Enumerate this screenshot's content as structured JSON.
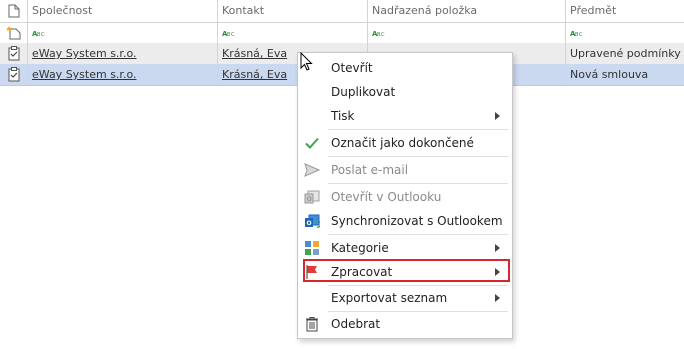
{
  "columns": {
    "company": "Společnost",
    "contact": "Kontakt",
    "parent": "Nadřazená položka",
    "subject": "Předmět"
  },
  "rows": [
    {
      "company": "eWay System s.r.o.",
      "contact": "Krásná, Eva",
      "parent": "",
      "subject": "Upravené podmínky"
    },
    {
      "company": "eWay System s.r.o.",
      "contact": "Krásná, Eva",
      "parent": "",
      "subject": "Nová smlouva"
    }
  ],
  "context_menu": {
    "items": [
      {
        "label": "Otevřít",
        "icon": "none",
        "submenu": false,
        "disabled": false
      },
      {
        "label": "Duplikovat",
        "icon": "none",
        "submenu": false,
        "disabled": false
      },
      {
        "label": "Tisk",
        "icon": "none",
        "submenu": true,
        "disabled": false
      },
      {
        "label": "Označit jako dokončené",
        "icon": "checkmark-icon",
        "submenu": false,
        "disabled": false
      },
      {
        "label": "Poslat e-mail",
        "icon": "send-icon",
        "submenu": false,
        "disabled": true
      },
      {
        "label": "Otevřít v Outlooku",
        "icon": "outlook-open-icon",
        "submenu": false,
        "disabled": true
      },
      {
        "label": "Synchronizovat s Outlookem",
        "icon": "outlook-sync-icon",
        "submenu": false,
        "disabled": false
      },
      {
        "label": "Kategorie",
        "icon": "categories-icon",
        "submenu": true,
        "disabled": false
      },
      {
        "label": "Zpracovat",
        "icon": "flag-icon",
        "submenu": true,
        "disabled": false,
        "highlighted": true
      },
      {
        "label": "Exportovat seznam",
        "icon": "none",
        "submenu": true,
        "disabled": false
      },
      {
        "label": "Odebrat",
        "icon": "trash-icon",
        "submenu": false,
        "disabled": false
      }
    ]
  },
  "colors": {
    "selected_row": "#cad9f0",
    "highlight_border": "#d9262c",
    "check_green": "#3aa94a"
  }
}
